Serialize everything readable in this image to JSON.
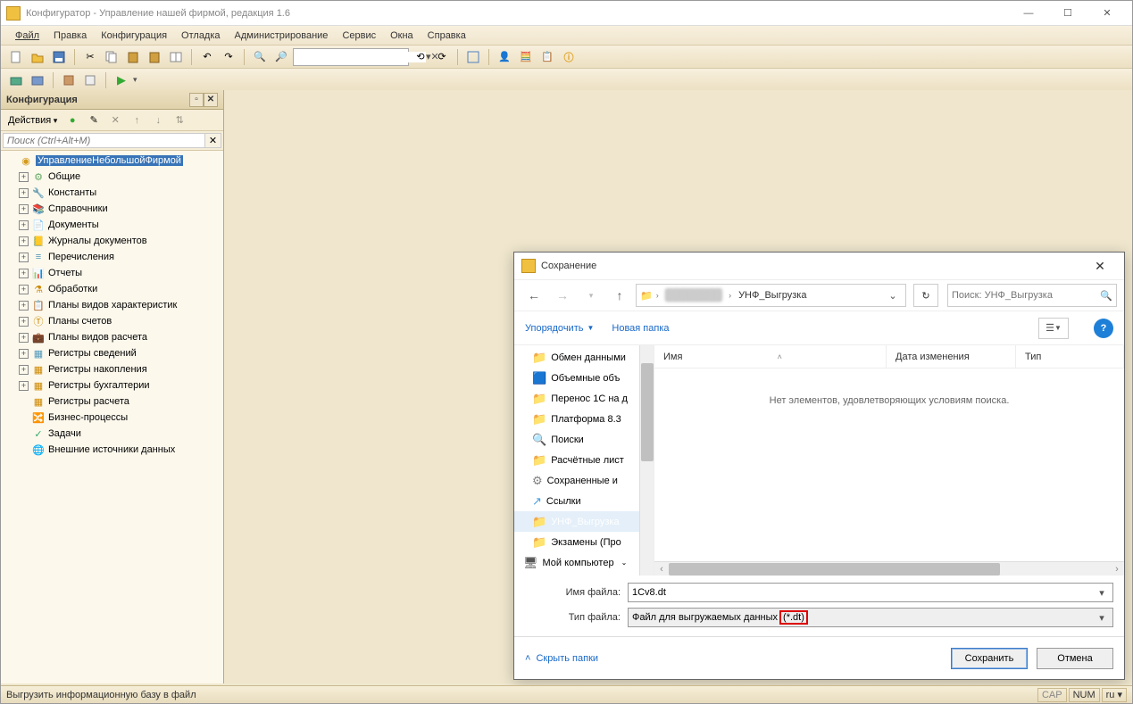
{
  "window": {
    "title": "Конфигуратор - Управление нашей фирмой, редакция 1.6",
    "min": "—",
    "max": "☐",
    "close": "✕"
  },
  "menu": {
    "file": "Файл",
    "edit": "Правка",
    "config": "Конфигурация",
    "debug": "Отладка",
    "admin": "Администрирование",
    "service": "Сервис",
    "windows": "Окна",
    "help": "Справка"
  },
  "panel": {
    "title": "Конфигурация",
    "actions": "Действия",
    "search_placeholder": "Поиск (Ctrl+Alt+M)"
  },
  "tree": {
    "root": "УправлениеНебольшойФирмой",
    "items": [
      "Общие",
      "Константы",
      "Справочники",
      "Документы",
      "Журналы документов",
      "Перечисления",
      "Отчеты",
      "Обработки",
      "Планы видов характеристик",
      "Планы счетов",
      "Планы видов расчета",
      "Регистры сведений",
      "Регистры накопления",
      "Регистры бухгалтерии",
      "Регистры расчета",
      "Бизнес-процессы",
      "Задачи",
      "Внешние источники данных"
    ]
  },
  "dialog": {
    "title": "Сохранение",
    "breadcrumb_current": "УНФ_Выгрузка",
    "search_placeholder": "Поиск: УНФ_Выгрузка",
    "organize": "Упорядочить",
    "newfolder": "Новая папка",
    "col_name": "Имя",
    "col_date": "Дата изменения",
    "col_type": "Тип",
    "empty_msg": "Нет элементов, удовлетворяющих условиям поиска.",
    "folders": [
      "Обмен данными",
      "Объемные объ",
      "Перенос 1С на д",
      "Платформа 8.3",
      "Поиски",
      "Расчётные лист",
      "Сохраненные и",
      "Ссылки",
      "УНФ_Выгрузка",
      "Экзамены (Про"
    ],
    "mycomputer": "Мой компьютер",
    "filename_label": "Имя файла:",
    "filetype_label": "Тип файла:",
    "filename_value": "1Cv8.dt",
    "filetype_value": "Файл для выгружаемых данных",
    "filetype_ext": "(*.dt)",
    "hide_folders": "Скрыть папки",
    "save": "Сохранить",
    "cancel": "Отмена"
  },
  "status": {
    "message": "Выгрузить информационную базу в файл",
    "cap": "CAP",
    "num": "NUM",
    "lang": "ru ▾"
  }
}
